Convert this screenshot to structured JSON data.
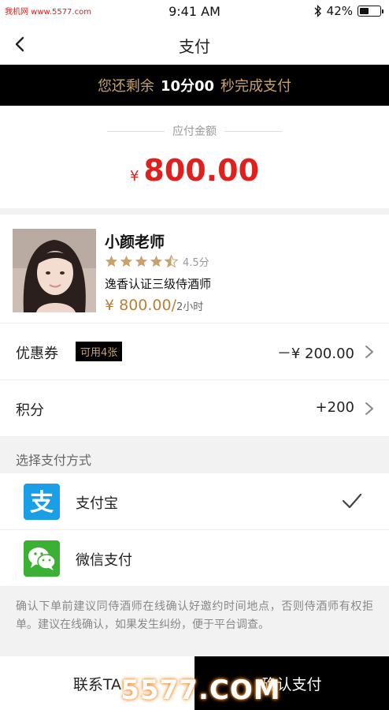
{
  "status_bar": {
    "watermark": "我机网 www.5577.com",
    "time": "9:41 AM",
    "battery": "42%"
  },
  "nav": {
    "title": "支付"
  },
  "timer": {
    "prefix": "您还剩余",
    "time_left": "10分00",
    "suffix": "秒完成支付"
  },
  "amount": {
    "label": "应付金额",
    "currency": "¥",
    "value": "800.00"
  },
  "profile": {
    "name": "小颜老师",
    "rating_stars": 4.5,
    "rating_text": "4.5分",
    "cert": "逸香认证三级侍酒师",
    "price": "¥ 800.00/",
    "unit": "2小时"
  },
  "coupon": {
    "label": "优惠券",
    "badge": "可用4张",
    "value": "－¥ 200.00"
  },
  "points": {
    "label": "积分",
    "value": "+200"
  },
  "payment": {
    "section_title": "选择支付方式",
    "options": [
      {
        "label": "支付宝",
        "selected": true,
        "color": "#1a9fe6"
      },
      {
        "label": "微信支付",
        "selected": false,
        "color": "#3cb034"
      }
    ]
  },
  "notice": "确认下单前建议同侍酒师在线确认好邀约时间地点，否则侍酒师有权拒单。建议在线确认，如果发生纠纷，便于平台调查。",
  "bottom": {
    "contact": "联系TA",
    "confirm": "确认支付"
  },
  "watermark_br": "5577.COM",
  "colors": {
    "gold": "#c9a26b",
    "price_red": "#e0201c",
    "alipay_blue": "#1a9fe6",
    "wechat_green": "#3cb034"
  }
}
